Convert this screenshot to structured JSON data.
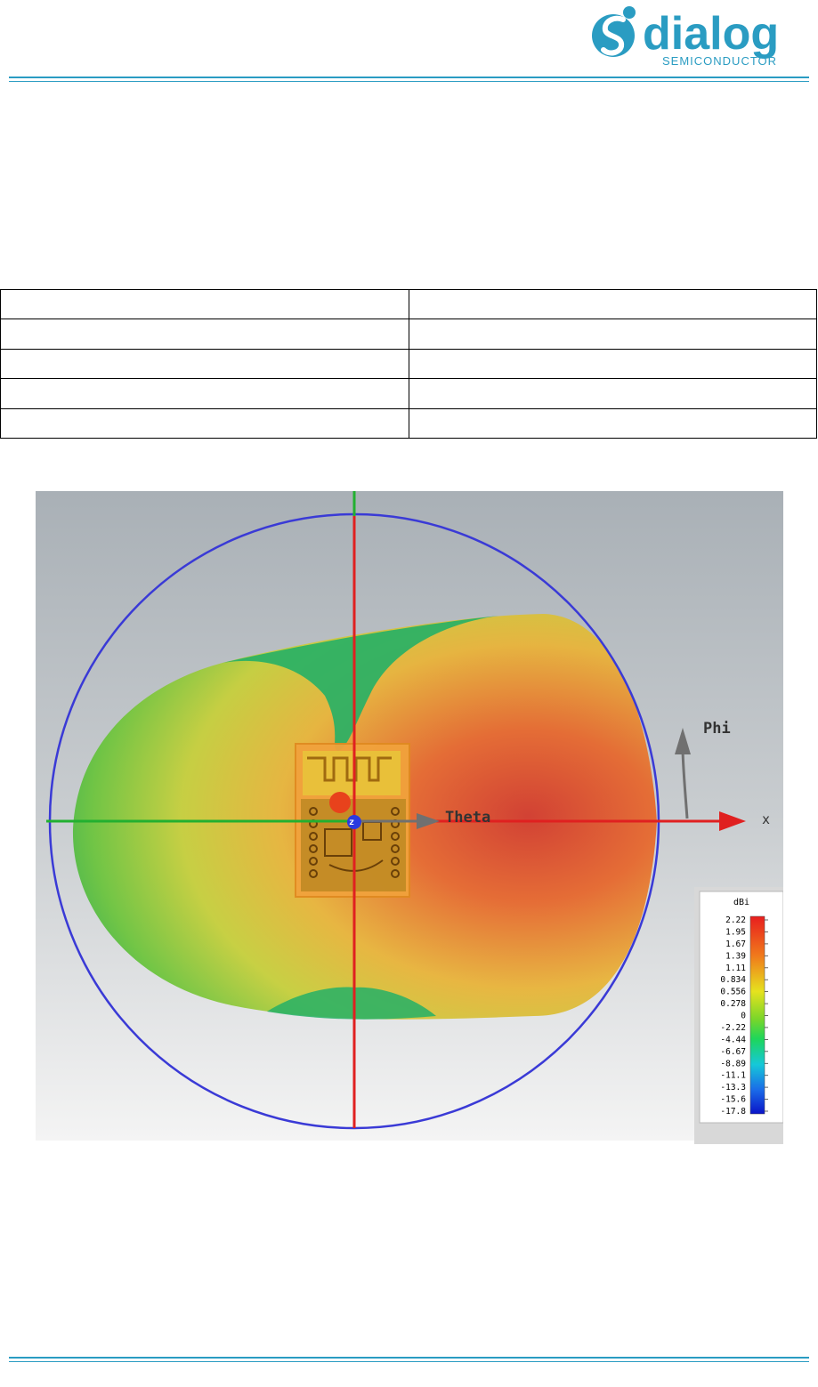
{
  "header": {
    "logo_word": "dialog",
    "logo_sub": "SEMICONDUCTOR",
    "brand_color": "#2a9cc2"
  },
  "table": {
    "rows": [
      [
        "",
        ""
      ],
      [
        "",
        ""
      ],
      [
        "",
        ""
      ],
      [
        "",
        ""
      ],
      [
        "",
        ""
      ]
    ]
  },
  "figure": {
    "axis_labels": {
      "phi": "Phi",
      "theta": "Theta",
      "x": "x",
      "z": "z"
    },
    "legend": {
      "unit": "dBi",
      "ticks": [
        "2.22",
        "1.95",
        "1.67",
        "1.39",
        "1.11",
        "0.834",
        "0.556",
        "0.278",
        "0",
        "-2.22",
        "-4.44",
        "-6.67",
        "-8.89",
        "-11.1",
        "-13.3",
        "-15.6",
        "-17.8"
      ]
    },
    "colors": {
      "circle": "#3a3ad6",
      "axis_red": "#e02020",
      "axis_green": "#22b030",
      "pattern_hot": "#d83a2a",
      "pattern_cool": "#2fb050"
    }
  }
}
